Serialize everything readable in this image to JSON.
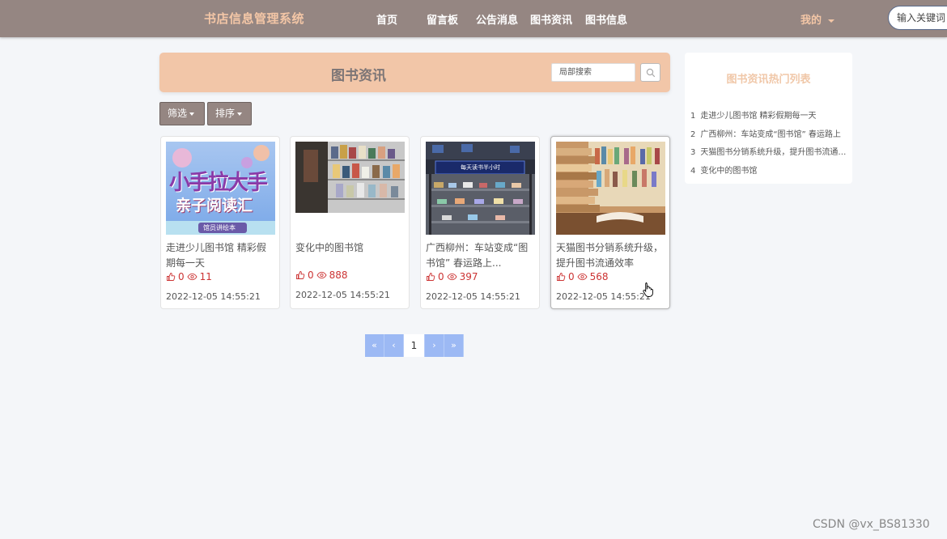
{
  "nav": {
    "brand": "书店信息管理系统",
    "items": [
      "首页",
      "留言板",
      "公告消息",
      "图书资讯",
      "图书信息"
    ],
    "mine": "我的",
    "search_placeholder": "输入关键词"
  },
  "header": {
    "title": "图书资讯",
    "search_placeholder": "局部搜索"
  },
  "filters": {
    "filter_label": "筛选",
    "sort_label": "排序"
  },
  "cards": [
    {
      "title": "走进少儿图书馆 精彩假期每一天",
      "likes": "0",
      "views": "11",
      "date": "2022-12-05 14:55:21",
      "image_text_1": "小手拉大手",
      "image_text_2": "亲子阅读汇",
      "image_text_3": "馆员讲绘本"
    },
    {
      "title": "变化中的图书馆",
      "likes": "0",
      "views": "888",
      "date": "2022-12-05 14:55:21"
    },
    {
      "title": "广西柳州：车站变成“图书馆” 春运路上...",
      "likes": "0",
      "views": "397",
      "date": "2022-12-05 14:55:21",
      "image_text_1": "每天读书半小时"
    },
    {
      "title": "天猫图书分销系统升级，提升图书流通效率",
      "likes": "0",
      "views": "568",
      "date": "2022-12-05 14:55:21"
    }
  ],
  "pager": {
    "first": "«",
    "prev": "‹",
    "current": "1",
    "next": "›",
    "last": "»"
  },
  "sidebar": {
    "title": "图书资讯热门列表",
    "items": [
      {
        "num": "1",
        "text": "走进少儿图书馆 精彩假期每一天"
      },
      {
        "num": "2",
        "text": "广西柳州：车站变成“图书馆” 春运路上"
      },
      {
        "num": "3",
        "text": "天猫图书分销系统升级，提升图书流通效率"
      },
      {
        "num": "4",
        "text": "变化中的图书馆"
      }
    ]
  },
  "watermark": "CSDN @vx_BS81330",
  "colors": {
    "topbar": "#958682",
    "brand": "#f3c6a6",
    "header_panel": "#f2c6a8",
    "pager": "#9cb9f4",
    "stats": "#cc3333"
  }
}
